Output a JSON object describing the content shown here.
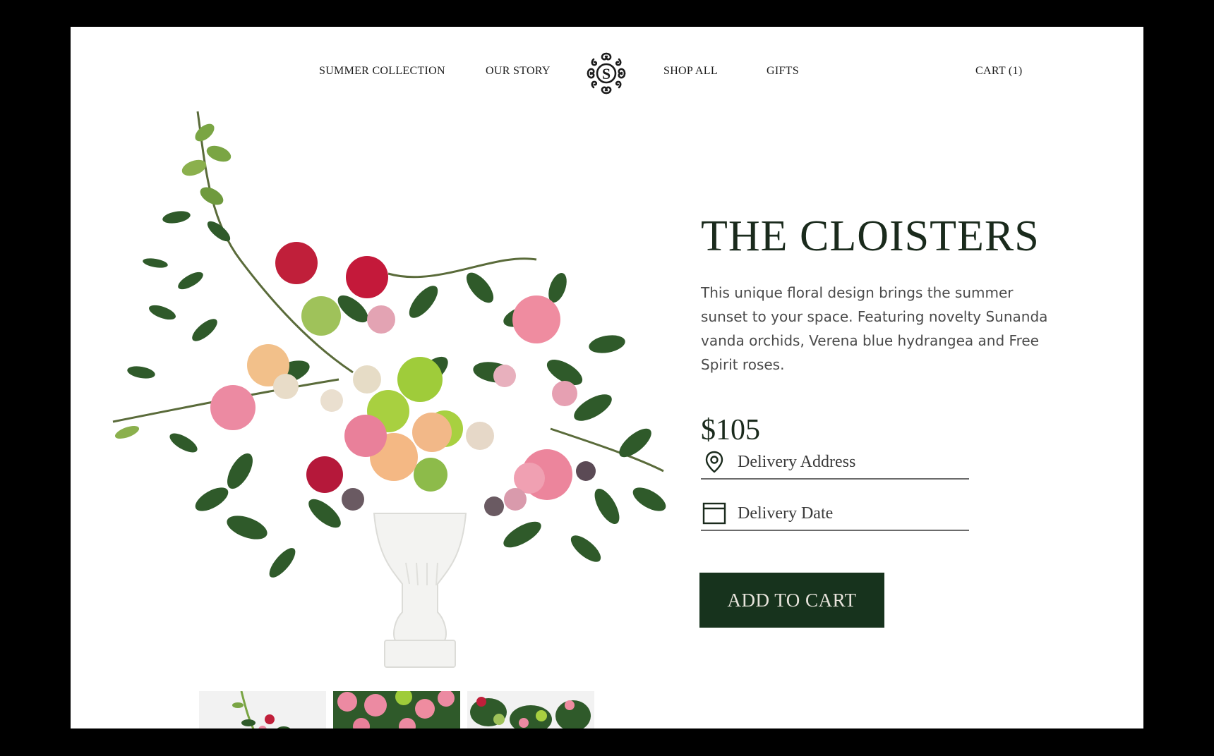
{
  "nav": {
    "summer_collection": "SUMMER COLLECTION",
    "our_story": "OUR STORY",
    "logo_letter": "S",
    "shop_all": "SHOP ALL",
    "gifts": "GIFTS",
    "cart": "CART (1)"
  },
  "product": {
    "title": "THE CLOISTERS",
    "description": "This unique floral design brings the summer sunset to your space. Featuring novelty Sunanda vanda orchids, Verena blue hydrangea and Free Spirit roses.",
    "price": "$105",
    "add_to_cart": "ADD TO CART"
  },
  "form": {
    "address_placeholder": "Delivery Address",
    "address_icon": "location-pin-icon",
    "date_placeholder": "Delivery Date",
    "date_icon": "calendar-icon"
  },
  "colors": {
    "brand_green": "#17331d",
    "title_text": "#1a2a1c",
    "body_text": "#4a4a4a"
  },
  "thumbnails": [
    "thumbnail-1",
    "thumbnail-2",
    "thumbnail-3"
  ]
}
